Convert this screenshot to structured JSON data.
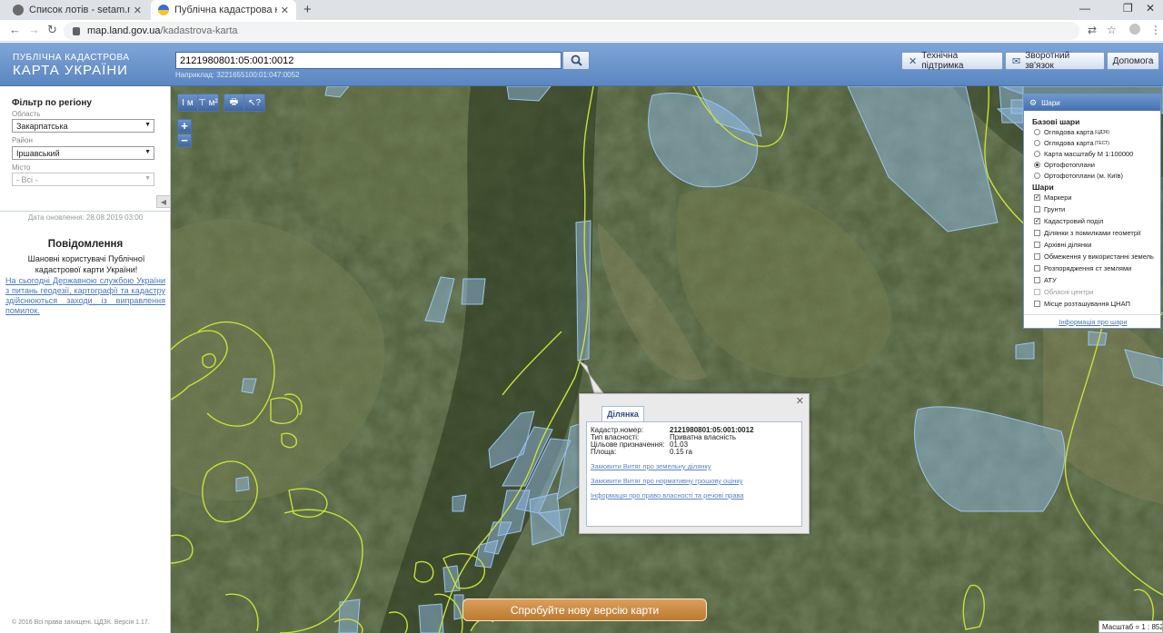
{
  "browser": {
    "tabs": [
      {
        "title": "Список лотів - setam.net.ua",
        "active": false
      },
      {
        "title": "Публічна кадастрова карта Укр",
        "active": true
      }
    ],
    "url_host": "map.land.gov.ua",
    "url_path": "/kadastrova-karta"
  },
  "header": {
    "logo_line1": "ПУБЛІЧНА КАДАСТРОВА",
    "logo_line2": "КАРТА УКРАЇНИ",
    "search_value": "2121980801:05:001:0012",
    "search_hint": "Наприклад: 3221655100:01:047:0052",
    "support_label": "Технічна підтримка",
    "feedback_label": "Зворотний зв'язок",
    "help_label": "Допомога"
  },
  "filter": {
    "title": "Фільтр по регіону",
    "oblast_label": "Область",
    "oblast_value": "Закарпатська",
    "rayon_label": "Район",
    "rayon_value": "Іршавський",
    "city_label": "Місто",
    "city_value": "- Всі -",
    "updated": "Дата оновлення: 28.08.2019 03:00"
  },
  "message": {
    "title": "Повідомлення",
    "body": "Шановні користувачі Публічної кадастрової карти України!",
    "link": "На сьогодні Державною службою України з питань геодезії, картографії та кадастру здійснюються заходи із виправлення помилок."
  },
  "footer": {
    "copyright": "© 2016 Всі права захищені. ЦДЗК. Версія 1.17."
  },
  "toolbar": {
    "measure_line": "I м",
    "measure_area": "⊤ м²",
    "print": "🖶",
    "info": "↖?"
  },
  "zoom": {
    "in": "+",
    "out": "−"
  },
  "parcel": {
    "tab": "Ділянка",
    "fields": [
      {
        "k": "Кадастр.номер:",
        "v": "2121980801:05:001:0012",
        "bold": true
      },
      {
        "k": "Тип власності:",
        "v": "Приватна власність"
      },
      {
        "k": "Цільове призначення:",
        "v": "01.03"
      },
      {
        "k": "Площа:",
        "v": "0.15 га"
      }
    ],
    "link1": "Замовити Витяг про земельну ділянку",
    "link2": "Замовити Витяг про нормативну грошову оцінку",
    "link3": "Інформація про право власності та речові права"
  },
  "layers": {
    "title": "Шари",
    "base_title": "Базові шари",
    "base": [
      {
        "label": "Оглядова карта",
        "sup": "(ЦДЗК)",
        "on": false
      },
      {
        "label": "Оглядова карта",
        "sup": "(ТЕСТ)",
        "on": false
      },
      {
        "label": "Карта масштабу М 1:100000",
        "sup": "",
        "on": false
      },
      {
        "label": "Ортофотоплани",
        "sup": "",
        "on": true
      },
      {
        "label": "Ортофотоплани (м. Київ)",
        "sup": "",
        "on": false
      }
    ],
    "layers_title": "Шари",
    "items": [
      {
        "label": "Маркери",
        "on": true,
        "dis": false
      },
      {
        "label": "Грунти",
        "on": false,
        "dis": false
      },
      {
        "label": "Кадастровий поділ",
        "on": true,
        "dis": false
      },
      {
        "label": "Ділянки з помилками геометрії",
        "on": false,
        "dis": false
      },
      {
        "label": "Архівні ділянки",
        "on": false,
        "dis": false
      },
      {
        "label": "Обмеження у використанні земель",
        "on": false,
        "dis": false
      },
      {
        "label": "Розпорядження ст землями",
        "on": false,
        "dis": false
      },
      {
        "label": "АТУ",
        "on": false,
        "dis": false
      },
      {
        "label": "Обласні центри",
        "on": false,
        "dis": true
      },
      {
        "label": "Місце розташування ЦНАП",
        "on": false,
        "dis": false
      }
    ],
    "info_link": "Інформація про шари"
  },
  "new_version": "Спробуйте нову версію карти",
  "scale": "Масштаб = 1 : 852",
  "colors": {
    "header": "#5b86c1",
    "parcel_fill": "#8fb7e0",
    "boundary": "#c8e03a",
    "link": "#4d78b8"
  }
}
